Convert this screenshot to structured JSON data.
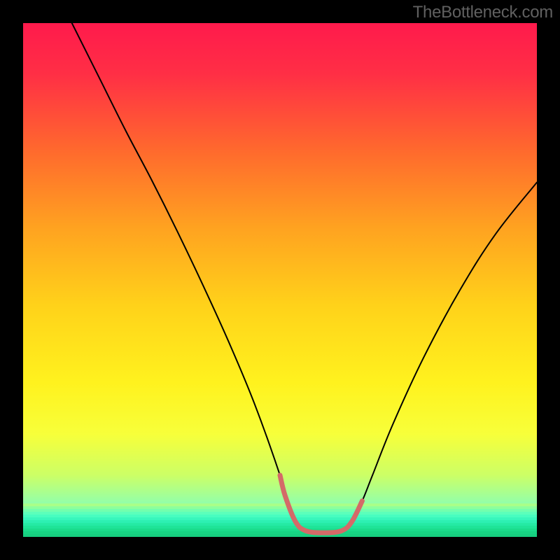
{
  "watermark": "TheBottleneck.com",
  "chart_data": {
    "type": "line",
    "title": "",
    "xlabel": "",
    "ylabel": "",
    "xlim": [
      0,
      100
    ],
    "ylim": [
      0,
      100
    ],
    "gradient_stops": [
      {
        "offset": 0.0,
        "color": "#ff1a4c"
      },
      {
        "offset": 0.1,
        "color": "#ff2f45"
      },
      {
        "offset": 0.25,
        "color": "#ff6a2d"
      },
      {
        "offset": 0.4,
        "color": "#ffa320"
      },
      {
        "offset": 0.55,
        "color": "#ffd21a"
      },
      {
        "offset": 0.7,
        "color": "#fff21e"
      },
      {
        "offset": 0.8,
        "color": "#f7ff3a"
      },
      {
        "offset": 0.88,
        "color": "#ccff66"
      },
      {
        "offset": 0.94,
        "color": "#8dffb0"
      },
      {
        "offset": 1.0,
        "color": "#17e884"
      }
    ],
    "series": [
      {
        "name": "bottleneck-curve",
        "color": "#000000",
        "width": 2,
        "x": [
          9.5,
          15,
          20,
          25,
          30,
          35,
          40,
          45,
          50,
          51,
          53,
          55,
          58.5,
          62,
          64,
          66,
          68,
          72,
          78,
          85,
          92,
          100
        ],
        "y": [
          100,
          89,
          79,
          69.5,
          59.5,
          49,
          38,
          26,
          12,
          8,
          3,
          1.2,
          0.8,
          1.2,
          3,
          7,
          12,
          22,
          35,
          48,
          59,
          69
        ]
      },
      {
        "name": "optimal-zone",
        "color": "#d46a68",
        "width": 7,
        "x": [
          50,
          51,
          53,
          55,
          58.5,
          62,
          64,
          66
        ],
        "y": [
          12,
          8,
          3,
          1.2,
          0.8,
          1.2,
          3,
          7
        ]
      }
    ],
    "green_band": {
      "top_fraction": 0.935,
      "stripes": [
        "#aaff88",
        "#8cff9d",
        "#72ffae",
        "#5bffbb",
        "#47fdc0",
        "#38f6bc",
        "#2df0b2",
        "#25eaa4",
        "#1fe497",
        "#1adc8b",
        "#17d483",
        "#17cf80"
      ]
    }
  }
}
